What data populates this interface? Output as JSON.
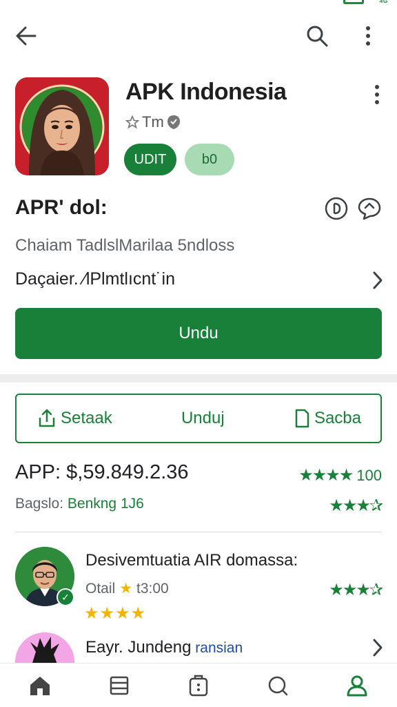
{
  "status": {
    "signal_text": "⁴ᴳ"
  },
  "app": {
    "name": "APK Indonesia",
    "developer": "Tm",
    "pill_primary": "UDIT",
    "pill_secondary": "b0"
  },
  "section": {
    "heading": "APR' dol:",
    "subtitle": "Chaiam TadlslMarilaa 5ndloss",
    "detail_label": "Daçaier. ⁄lPlmtlıcnt˙in"
  },
  "install": {
    "label": "Undu"
  },
  "actions": [
    {
      "label": "Setaak",
      "icon": "share-icon"
    },
    {
      "label": "Unduj",
      "icon": ""
    },
    {
      "label": "Sacba",
      "icon": "bookmark-icon"
    }
  ],
  "price": {
    "text": "APP: $,59.849.2.36",
    "rating_stars": "★★★★",
    "rating_value": "100"
  },
  "reviews": {
    "label": "Bagslo: ",
    "value": "Benkng 1J6",
    "stars": "★★★✰"
  },
  "review_card": {
    "title": "Desivemtuatia AIR domassa:",
    "meta_prefix": "Otail",
    "meta_star": "★",
    "meta_value": "t3:00",
    "stars": "★★★★",
    "rating_stars": "★★★✰"
  },
  "next_item": {
    "title": "Eayr. Jundeng",
    "accent": " ransian"
  },
  "colors": {
    "brand_green": "#188038",
    "light_green": "#a8dbb4",
    "star_yellow": "#f4b400",
    "icon_red": "#c8202a"
  },
  "nav": [
    "home-icon",
    "list-icon",
    "apps-icon",
    "search-nav-icon",
    "profile-icon"
  ]
}
